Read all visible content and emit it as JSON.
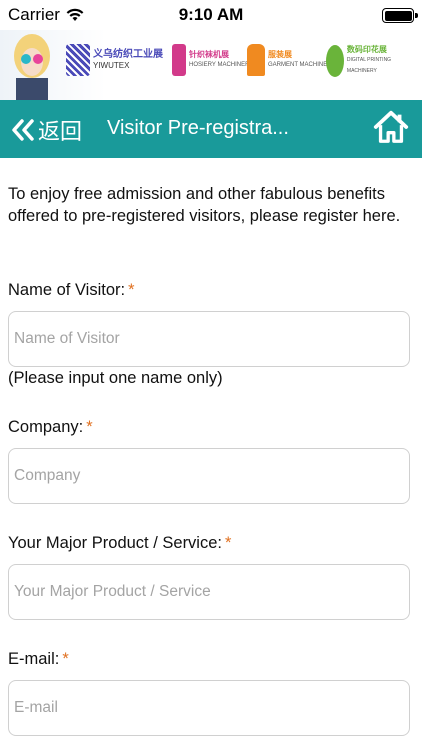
{
  "status_bar": {
    "carrier": "Carrier",
    "time": "9:10 AM"
  },
  "banner": {
    "logos": [
      {
        "cn": "义乌纺织工业展",
        "en": "YIWUTEX",
        "icon": "yiwutex-logo-icon",
        "color": "#4a4ab8"
      },
      {
        "cn": "针织袜机展",
        "en": "HOSIERY MACHINERY",
        "icon": "hosiery-logo-icon",
        "color": "#d23a8a"
      },
      {
        "cn": "服装展",
        "en": "GARMENT MACHINERY",
        "icon": "garment-logo-icon",
        "color": "#f08a20"
      },
      {
        "cn": "数码印花展",
        "en": "DIGITAL PRINTING MACHINERY",
        "icon": "printing-logo-icon",
        "color": "#6ab43a"
      }
    ]
  },
  "nav": {
    "back_label": "返回",
    "title": "Visitor Pre-registra...",
    "accent": "#199a9a"
  },
  "intro": "To enjoy free admission and other fabulous benefits offered to pre-registered visitors, please register here.",
  "form": {
    "name": {
      "label": "Name of Visitor:",
      "required": "*",
      "placeholder": "Name of Visitor",
      "hint": "(Please input one name only)"
    },
    "company": {
      "label": "Company:",
      "required": "*",
      "placeholder": "Company"
    },
    "product": {
      "label": "Your Major Product / Service:",
      "required": "*",
      "placeholder": "Your Major Product / Service"
    },
    "email": {
      "label": "E-mail:",
      "required": "*",
      "placeholder": "E-mail"
    }
  }
}
